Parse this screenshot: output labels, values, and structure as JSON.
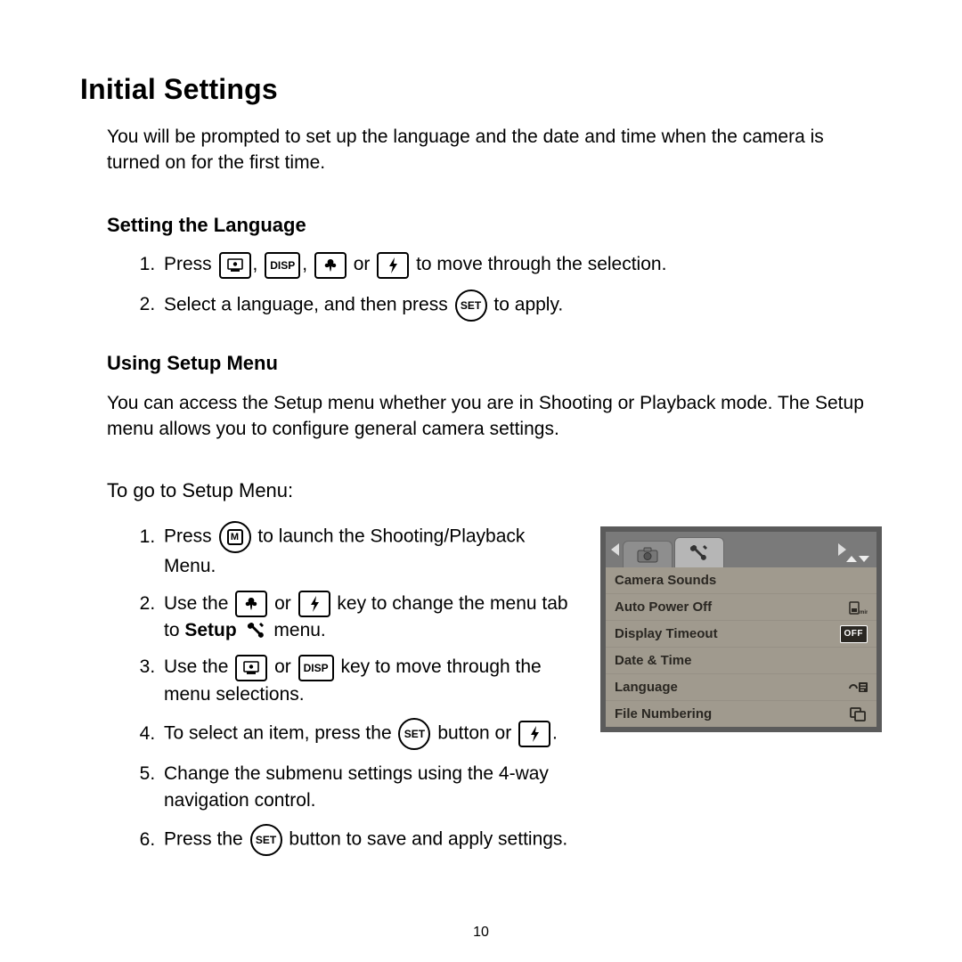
{
  "page_number": "10",
  "title": "Initial Settings",
  "intro": "You will be prompted to set up the language and the date and time when the camera is turned on for the first time.",
  "sec_lang": {
    "heading": "Setting the Language",
    "step1_a": "Press ",
    "step1_b": " or ",
    "step1_c": " to move through the selection.",
    "step2_a": "Select a language, and then press ",
    "step2_b": " to apply."
  },
  "sec_setup": {
    "heading": "Using Setup Menu",
    "intro": "You can access the Setup menu whether you are in Shooting or Playback mode. The Setup menu allows you to configure general camera settings.",
    "subheading": "To go to Setup Menu:",
    "s1a": "Press ",
    "s1b": " to launch the Shooting/Playback Menu.",
    "s2a": "Use the ",
    "s2b": " or ",
    "s2c": " key to change the menu tab to ",
    "s2d": "Setup",
    "s2e": " menu.",
    "s3a": "Use the ",
    "s3b": " or ",
    "s3c": " key to move through the menu selections.",
    "s4a": "To select an item, press the ",
    "s4b": " button or ",
    "s4c": ".",
    "s5": "Change the submenu settings using the 4-way navigation control.",
    "s6a": "Press the ",
    "s6b": " button to save and apply settings."
  },
  "icon_labels": {
    "disp": "DISP",
    "set": "SET",
    "menu_m": "M"
  },
  "lcd": {
    "rows": [
      {
        "label": "Camera Sounds",
        "value_type": "none"
      },
      {
        "label": "Auto Power Off",
        "value_type": "timer",
        "value": "1min"
      },
      {
        "label": "Display Timeout",
        "value_type": "off",
        "value": "OFF"
      },
      {
        "label": "Date & Time",
        "value_type": "none"
      },
      {
        "label": "Language",
        "value_type": "lang"
      },
      {
        "label": "File Numbering",
        "value_type": "copy"
      }
    ]
  }
}
